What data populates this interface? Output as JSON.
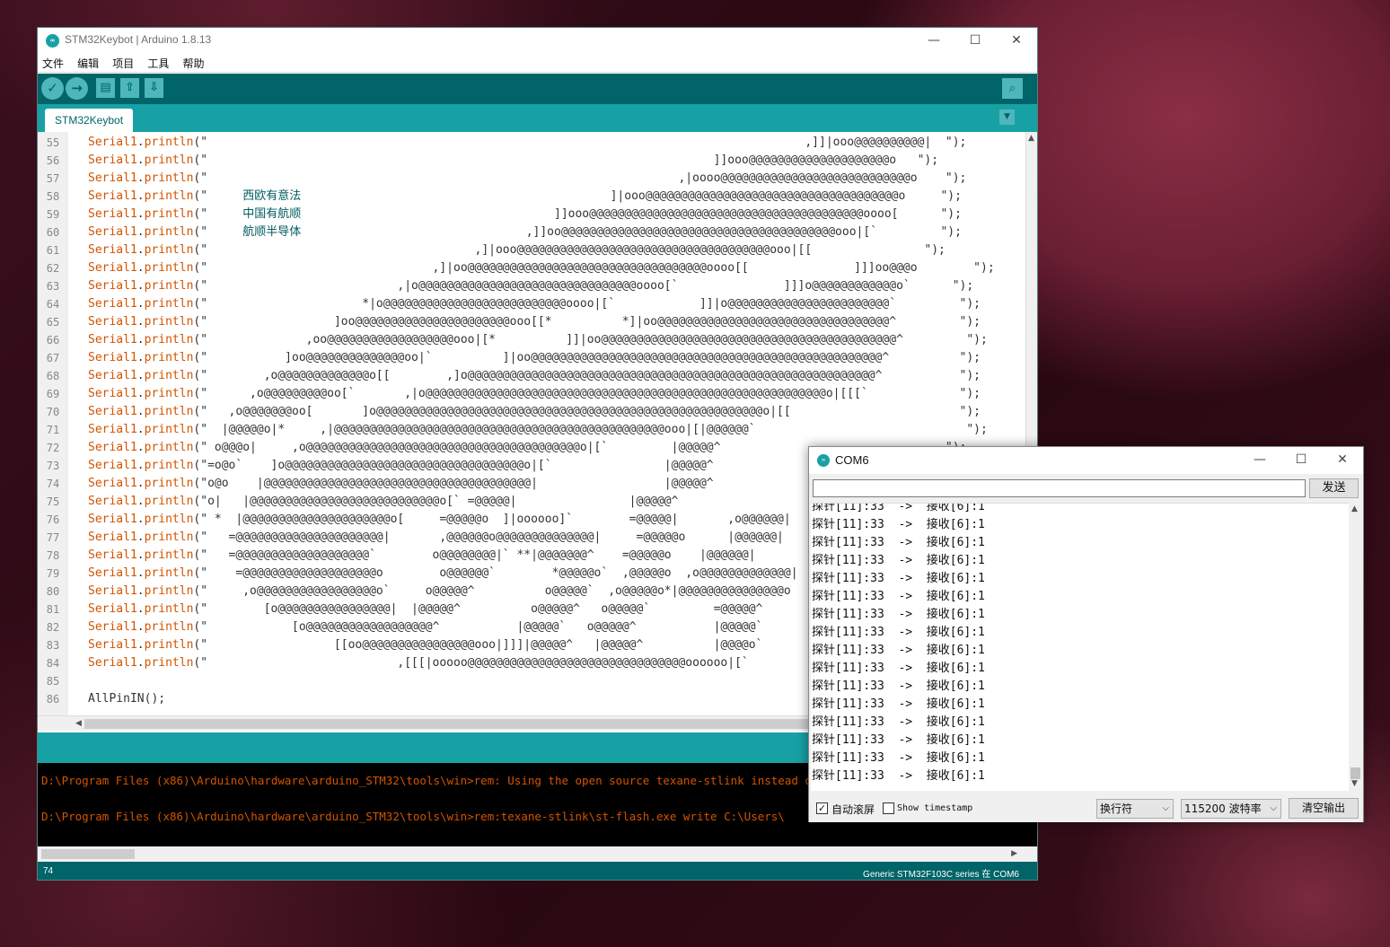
{
  "ide": {
    "title": "STM32Keybot | Arduino 1.8.13",
    "menu": [
      "文件",
      "编辑",
      "项目",
      "工具",
      "帮助"
    ],
    "tab": "STM32Keybot",
    "code_lines": [
      {
        "n": "55",
        "text": "Serial1.println(\"                                                                                     ,]]|ooo@@@@@@@@@@|  \");"
      },
      {
        "n": "56",
        "text": "Serial1.println(\"                                                                        ]]ooo@@@@@@@@@@@@@@@@@@@@o   \");"
      },
      {
        "n": "57",
        "text": "Serial1.println(\"                                                                   ,|oooo@@@@@@@@@@@@@@@@@@@@@@@@@@@o    \");"
      },
      {
        "n": "58",
        "text": "Serial1.println(\"     西欧有意法                                            ]|ooo@@@@@@@@@@@@@@@@@@@@@@@@@@@@@@@@@@@@o     \");"
      },
      {
        "n": "59",
        "text": "Serial1.println(\"     中国有航顺                                    ]]ooo@@@@@@@@@@@@@@@@@@@@@@@@@@@@@@@@@@@@@@@oooo[      \");"
      },
      {
        "n": "60",
        "text": "Serial1.println(\"     航顺半导体                                ,]]oo@@@@@@@@@@@@@@@@@@@@@@@@@@@@@@@@@@@@@@@ooo|[`         \");"
      },
      {
        "n": "61",
        "text": "Serial1.println(\"                                      ,]|ooo@@@@@@@@@@@@@@@@@@@@@@@@@@@@@@@@@@@@ooo|[[                \");"
      },
      {
        "n": "62",
        "text": "Serial1.println(\"                                ,]|oo@@@@@@@@@@@@@@@@@@@@@@@@@@@@@@@@@@oooo[[               ]]]oo@@@o        \");"
      },
      {
        "n": "63",
        "text": "Serial1.println(\"                           ,|o@@@@@@@@@@@@@@@@@@@@@@@@@@@@@@@oooo[`               ]]]o@@@@@@@@@@@@o`      \");"
      },
      {
        "n": "64",
        "text": "Serial1.println(\"                      *|o@@@@@@@@@@@@@@@@@@@@@@@@@@oooo|[`            ]]|o@@@@@@@@@@@@@@@@@@@@@@@`         \");"
      },
      {
        "n": "65",
        "text": "Serial1.println(\"                  ]oo@@@@@@@@@@@@@@@@@@@@@@ooo[[*          *]|oo@@@@@@@@@@@@@@@@@@@@@@@@@@@@@@@@@^         \");"
      },
      {
        "n": "66",
        "text": "Serial1.println(\"              ,oo@@@@@@@@@@@@@@@@@@ooo|[*          ]]|oo@@@@@@@@@@@@@@@@@@@@@@@@@@@@@@@@@@@@@@@@@@^         \");"
      },
      {
        "n": "67",
        "text": "Serial1.println(\"           ]oo@@@@@@@@@@@@@@oo|`          ]|oo@@@@@@@@@@@@@@@@@@@@@@@@@@@@@@@@@@@@@@@@@@@@@@@@@@^          \");"
      },
      {
        "n": "68",
        "text": "Serial1.println(\"        ,o@@@@@@@@@@@@@o[[        ,]o@@@@@@@@@@@@@@@@@@@@@@@@@@@@@@@@@@@@@@@@@@@@@@@@@@@@@@@@@@^           \");"
      },
      {
        "n": "69",
        "text": "Serial1.println(\"      ,o@@@@@@@@@oo[`       ,|o@@@@@@@@@@@@@@@@@@@@@@@@@@@@@@@@@@@@@@@@@@@@@@@@@@@@@@@@@o|[[[`             \");"
      },
      {
        "n": "70",
        "text": "Serial1.println(\"   ,o@@@@@@@oo[       ]o@@@@@@@@@@@@@@@@@@@@@@@@@@@@@@@@@@@@@@@@@@@@@@@@@@@@@@@o|[[                        \");"
      },
      {
        "n": "71",
        "text": "Serial1.println(\"  |@@@@@o|*     ,|@@@@@@@@@@@@@@@@@@@@@@@@@@@@@@@@@@@@@@@@@@@@@@@ooo|[|@@@@@@`                              \");"
      },
      {
        "n": "72",
        "text": "Serial1.println(\" o@@@o|     ,o@@@@@@@@@@@@@@@@@@@@@@@@@@@@@@@@@@@@@@@o|[`         |@@@@@^                                \");"
      },
      {
        "n": "73",
        "text": "Serial1.println(\"=o@o`    ]o@@@@@@@@@@@@@@@@@@@@@@@@@@@@@@@@@@o|[`                |@@@@@^                                 \");"
      },
      {
        "n": "74",
        "text": "Serial1.println(\"o@o    |@@@@@@@@@@@@@@@@@@@@@@@@@@@@@@@@@@@@@@|                  |@@@@@^                                  \");"
      },
      {
        "n": "75",
        "text": "Serial1.println(\"o|   |@@@@@@@@@@@@@@@@@@@@@@@@@@@o[` =@@@@@|                |@@@@@^                                   \");"
      },
      {
        "n": "76",
        "text": "Serial1.println(\" *  |@@@@@@@@@@@@@@@@@@@@@o[     =@@@@@o  ]|oooooo]`        =@@@@@|       ,o@@@@@@|                   \");"
      },
      {
        "n": "77",
        "text": "Serial1.println(\"   =@@@@@@@@@@@@@@@@@@@@@|       ,@@@@@@o@@@@@@@@@@@@@@|     =@@@@@o      |@@@@@@|                    \");"
      },
      {
        "n": "78",
        "text": "Serial1.println(\"   =@@@@@@@@@@@@@@@@@@@`        o@@@@@@@@|` **|@@@@@@@^    =@@@@@o    |@@@@@@|                     \");"
      },
      {
        "n": "79",
        "text": "Serial1.println(\"    =@@@@@@@@@@@@@@@@@@@o        o@@@@@@`        *@@@@@o`  ,@@@@@o  ,o@@@@@@@@@@@@@|                      \");"
      },
      {
        "n": "80",
        "text": "Serial1.println(\"     ,o@@@@@@@@@@@@@@@@@o`     o@@@@@^          o@@@@@`  ,o@@@@@o*|@@@@@@@@@@@@@@@o                       \");"
      },
      {
        "n": "81",
        "text": "Serial1.println(\"        [o@@@@@@@@@@@@@@@@|  |@@@@@^          o@@@@@^   o@@@@@`         =@@@@@^                        \");"
      },
      {
        "n": "82",
        "text": "Serial1.println(\"            [o@@@@@@@@@@@@@@@@@@^           |@@@@@`   o@@@@@^           |@@@@@`                         \");"
      },
      {
        "n": "83",
        "text": "Serial1.println(\"                  [[oo@@@@@@@@@@@@@@@@ooo|]]]|@@@@@^   |@@@@@^          |@@@@o`                          \");"
      },
      {
        "n": "84",
        "text": "Serial1.println(\"                           ,[[[|ooooo@@@@@@@@@@@@@@@@@@@@@@@@@@@@@@@oooooo|[`                               \");"
      },
      {
        "n": "85",
        "text": ""
      },
      {
        "n": "86",
        "text": "AllPinIN();"
      }
    ],
    "console": [
      "D:\\Program Files (x86)\\Arduino\\hardware\\arduino_STM32\\tools\\win>rem: Using the open source texane-stlink instead of the proprietary STM stlink exe",
      "D:\\Program Files (x86)\\Arduino\\hardware\\arduino_STM32\\tools\\win>rem:texane-stlink\\st-flash.exe write C:\\Users\\"
    ],
    "status_line": "74",
    "board": "Generic STM32F103C series 在 COM6"
  },
  "serial": {
    "title": "COM6",
    "send_label": "发送",
    "input_value": "",
    "lines": [
      "探针[11]:33  ->  接收[6]:1",
      "探针[11]:33  ->  接收[6]:1",
      "探针[11]:33  ->  接收[6]:1",
      "探针[11]:33  ->  接收[6]:1",
      "探针[11]:33  ->  接收[6]:1",
      "探针[11]:33  ->  接收[6]:1",
      "探针[11]:33  ->  接收[6]:1",
      "探针[11]:33  ->  接收[6]:1",
      "探针[11]:33  ->  接收[6]:1",
      "探针[11]:33  ->  接收[6]:1",
      "探针[11]:33  ->  接收[6]:1",
      "探针[11]:33  ->  接收[6]:1",
      "探针[11]:33  ->  接收[6]:1",
      "探针[11]:33  ->  接收[6]:1",
      "探针[11]:33  ->  接收[6]:1",
      "探针[11]:33  ->  接收[6]:1"
    ],
    "autoscroll_label": "自动滚屏",
    "autoscroll_checked": true,
    "timestamp_label": "Show timestamp",
    "timestamp_checked": false,
    "line_ending": "换行符",
    "baud": "115200 波特率",
    "clear_label": "清空输出"
  },
  "colors": {
    "toolbar": "#006468",
    "tabbar": "#17a1a5",
    "keyword": "#d35400",
    "console_text": "#d35400"
  }
}
